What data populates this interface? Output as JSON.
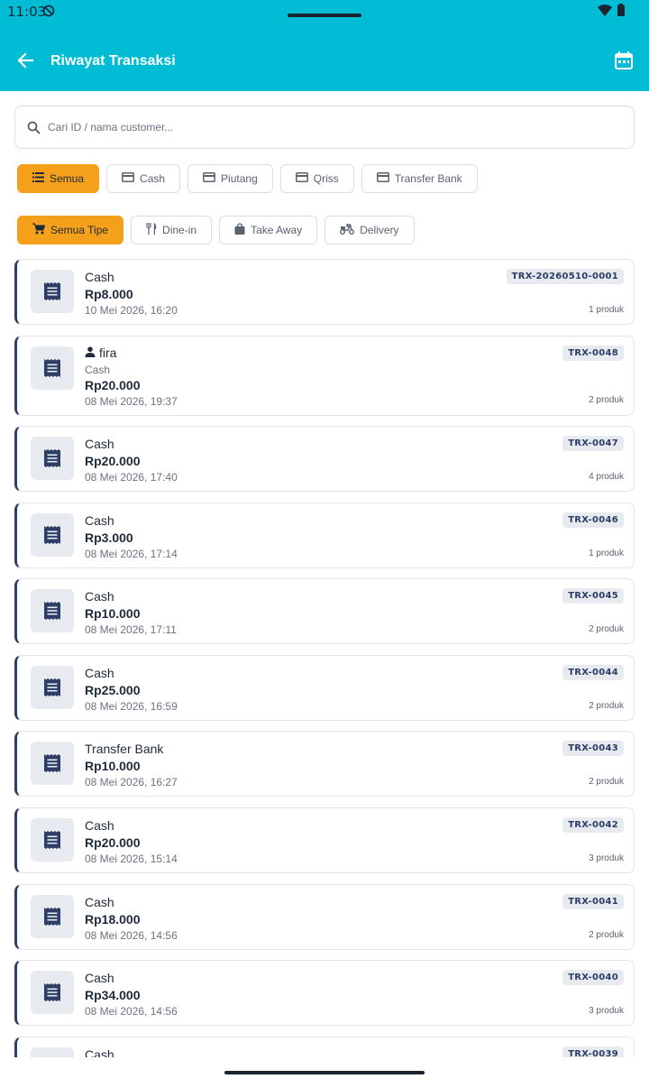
{
  "status_bar": {
    "time": "11:03",
    "dnd_icon": "do-not-disturb-icon",
    "wifi_icon": "wifi-icon",
    "battery_icon": "battery-icon"
  },
  "app_bar": {
    "title": "Riwayat Transaksi",
    "back_icon": "arrow-back-icon",
    "calendar_icon": "calendar-icon",
    "background": "#00bcd4"
  },
  "search": {
    "placeholder": "Cari ID / nama customer...",
    "value": "",
    "icon": "search-icon"
  },
  "payment_filters": [
    {
      "label": "Semua",
      "icon": "list-icon",
      "active": true
    },
    {
      "label": "Cash",
      "icon": "card-icon",
      "active": false
    },
    {
      "label": "Piutang",
      "icon": "card-icon",
      "active": false
    },
    {
      "label": "Qriss",
      "icon": "card-icon",
      "active": false
    },
    {
      "label": "Transfer Bank",
      "icon": "card-icon",
      "active": false
    }
  ],
  "type_filters": [
    {
      "label": "Semua Tipe",
      "icon": "cart-icon",
      "active": true
    },
    {
      "label": "Dine-in",
      "icon": "cutlery-icon",
      "active": false
    },
    {
      "label": "Take Away",
      "icon": "bag-icon",
      "active": false
    },
    {
      "label": "Delivery",
      "icon": "scooter-icon",
      "active": false
    }
  ],
  "transactions": [
    {
      "id": "TRX-20260510-0001",
      "method": "Cash",
      "customer": "",
      "amount": "Rp8.000",
      "date": "10 Mei 2026, 16:20",
      "count": "1 produk"
    },
    {
      "id": "TRX-0048",
      "method": "Cash",
      "customer": "fira",
      "amount": "Rp20.000",
      "date": "08 Mei 2026, 19:37",
      "count": "2 produk"
    },
    {
      "id": "TRX-0047",
      "method": "Cash",
      "customer": "",
      "amount": "Rp20.000",
      "date": "08 Mei 2026, 17:40",
      "count": "4 produk"
    },
    {
      "id": "TRX-0046",
      "method": "Cash",
      "customer": "",
      "amount": "Rp3.000",
      "date": "08 Mei 2026, 17:14",
      "count": "1 produk"
    },
    {
      "id": "TRX-0045",
      "method": "Cash",
      "customer": "",
      "amount": "Rp10.000",
      "date": "08 Mei 2026, 17:11",
      "count": "2 produk"
    },
    {
      "id": "TRX-0044",
      "method": "Cash",
      "customer": "",
      "amount": "Rp25.000",
      "date": "08 Mei 2026, 16:59",
      "count": "2 produk"
    },
    {
      "id": "TRX-0043",
      "method": "Transfer Bank",
      "customer": "",
      "amount": "Rp10.000",
      "date": "08 Mei 2026, 16:27",
      "count": "2 produk"
    },
    {
      "id": "TRX-0042",
      "method": "Cash",
      "customer": "",
      "amount": "Rp20.000",
      "date": "08 Mei 2026, 15:14",
      "count": "3 produk"
    },
    {
      "id": "TRX-0041",
      "method": "Cash",
      "customer": "",
      "amount": "Rp18.000",
      "date": "08 Mei 2026, 14:56",
      "count": "2 produk"
    },
    {
      "id": "TRX-0040",
      "method": "Cash",
      "customer": "",
      "amount": "Rp34.000",
      "date": "08 Mei 2026, 14:56",
      "count": "3 produk"
    },
    {
      "id": "TRX-0039",
      "method": "Cash",
      "customer": "",
      "amount": "",
      "date": "",
      "count": ""
    }
  ],
  "colors": {
    "accent": "#f5a01a",
    "primary": "#00bcd4",
    "card_stripe": "#2c3e66"
  }
}
